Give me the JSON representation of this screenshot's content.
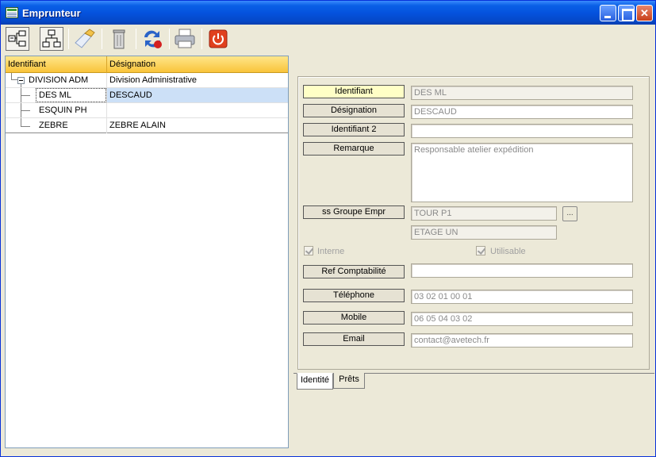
{
  "window": {
    "title": "Emprunteur"
  },
  "toolbar": {
    "icons": [
      "tree-expand-icon",
      "tree-structure-icon",
      "eraser-icon",
      "trash-bin-icon",
      "refresh-icon",
      "printer-icon",
      "power-icon"
    ]
  },
  "grid": {
    "headers": {
      "id": "Identifiant",
      "designation": "Désignation"
    },
    "rows": [
      {
        "id": "DIVISION ADM",
        "designation": "Division Administrative"
      },
      {
        "id": "DES ML",
        "designation": "DESCAUD"
      },
      {
        "id": "ESQUIN PH",
        "designation": ""
      },
      {
        "id": "ZEBRE",
        "designation": "ZEBRE ALAIN"
      }
    ]
  },
  "form": {
    "identifiant": {
      "label": "Identifiant",
      "value": "DES ML"
    },
    "designation": {
      "label": "Désignation",
      "value": "DESCAUD"
    },
    "identifiant2": {
      "label": "Identifiant 2",
      "value": ""
    },
    "remarque": {
      "label": "Remarque",
      "value": "Responsable atelier expédition"
    },
    "groupe": {
      "label": "ss Groupe Empr",
      "value1": "TOUR P1",
      "value2": "ETAGE UN",
      "button": "..."
    },
    "interne": {
      "label": "Interne",
      "checked": true
    },
    "utilisable": {
      "label": "Utilisable",
      "checked": true
    },
    "ref_compta": {
      "label": "Ref Comptabilité",
      "value": ""
    },
    "telephone": {
      "label": "Téléphone",
      "value": "03 02 01 00 01"
    },
    "mobile": {
      "label": "Mobile",
      "value": "06 05 04 03 02"
    },
    "email": {
      "label": "Email",
      "value": "contact@avetech.fr"
    }
  },
  "tabs": {
    "identite": "Identité",
    "prets": "Prêts"
  },
  "colors": {
    "title_bar": "#0553de",
    "grid_header": "#f9c43a",
    "selected_row": "#cce0f7",
    "active_label": "#ffffc6"
  }
}
